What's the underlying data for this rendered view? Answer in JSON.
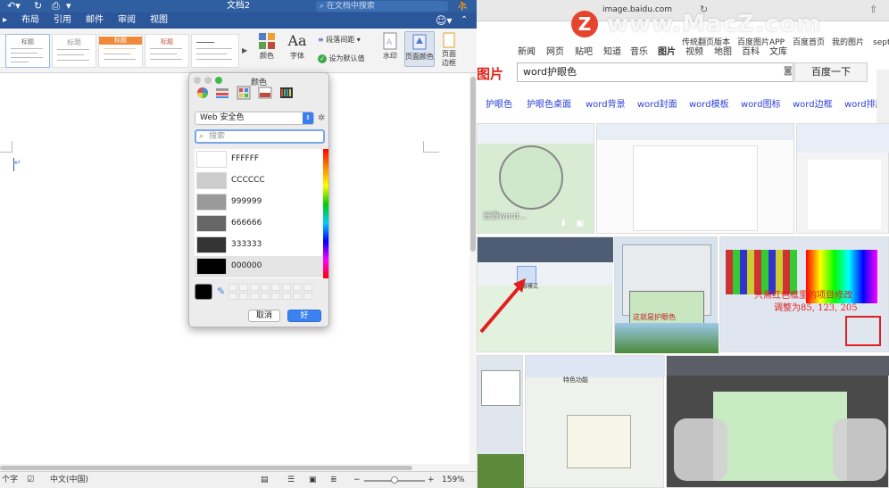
{
  "word": {
    "document_title": "文档2",
    "search_placeholder": "在文档中搜索",
    "ribbon_tabs": [
      "布局",
      "引用",
      "邮件",
      "审阅",
      "视图"
    ],
    "style_labels": [
      "标题",
      "标题",
      "标题",
      "标题"
    ],
    "ribbon_buttons": {
      "colors": "颜色",
      "fonts": "字体",
      "font_icon": "Aa",
      "paragraph_spacing": "段落间距",
      "set_default": "设为默认值",
      "watermark": "水印",
      "page_color": "页面颜色",
      "page_borders_1": "页面",
      "page_borders_2": "边框"
    },
    "status": {
      "word_count": "个字",
      "language": "中文(中国)",
      "zoom": "159%"
    }
  },
  "color_panel": {
    "title": "颜色",
    "palette_name": "Web 安全色",
    "search_placeholder": "搜索",
    "swatches": [
      {
        "label": "FFFFFF",
        "color": "#FFFFFF"
      },
      {
        "label": "CCCCCC",
        "color": "#CCCCCC"
      },
      {
        "label": "999999",
        "color": "#999999"
      },
      {
        "label": "666666",
        "color": "#666666"
      },
      {
        "label": "333333",
        "color": "#333333"
      },
      {
        "label": "000000",
        "color": "#000000"
      }
    ],
    "selected_label": "000000",
    "current_color": "#000000",
    "cancel_label": "取消",
    "ok_label": "好"
  },
  "browser": {
    "url": "image.baidu.com",
    "nav_links": [
      "新闻",
      "网页",
      "贴吧",
      "知道",
      "音乐",
      "图片",
      "视频",
      "地图",
      "百科",
      "文库"
    ],
    "top_links": [
      "传统翻页版本",
      "百度图片APP",
      "百度首页",
      "我的图片",
      "septe"
    ],
    "logo_text": "图片",
    "search_value": "word护眼色",
    "search_button": "百度一下",
    "related": [
      "护眼色",
      "护眼色桌面",
      "word背景",
      "word封面",
      "word模板",
      "word图标",
      "word边框",
      "word排版"
    ],
    "thumb_captions": {
      "t1": "设置word...",
      "t2": "护眼模式",
      "t3": "这就是护眼色",
      "t4a": "只需红色框里的项目修改",
      "t4b": "调整为85, 123, 205",
      "t5": "特色功能"
    }
  },
  "watermark": "www.MacZ.com",
  "colors": {
    "word_blue": "#2b579a",
    "baidu_red": "#e2231a",
    "link_blue": "#2f42d6",
    "mac_blue": "#3b82f0"
  }
}
